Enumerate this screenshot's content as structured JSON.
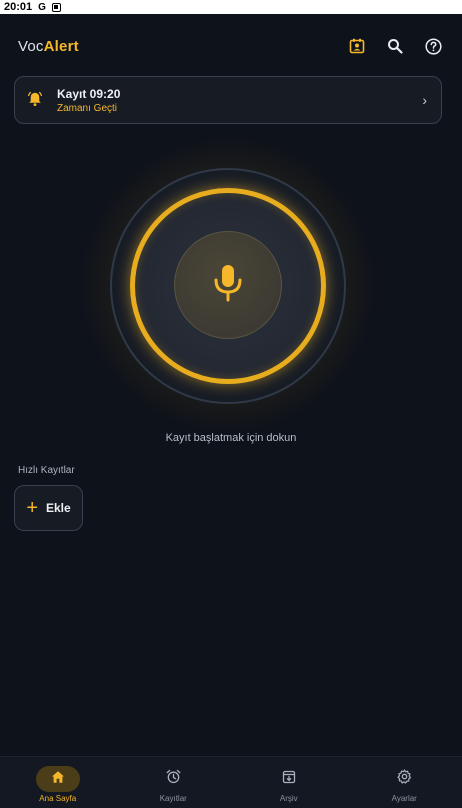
{
  "status_bar": {
    "time": "20:01",
    "icons": [
      "google-g",
      "a-box"
    ]
  },
  "app": {
    "name_prefix": "Voc",
    "name_suffix": "Alert"
  },
  "appbar_actions": [
    "contact-card-icon",
    "search-icon",
    "help-icon"
  ],
  "alert": {
    "title": "Kayıt 09:20",
    "subtitle": "Zamanı Geçti",
    "icon": "bell-icon"
  },
  "record": {
    "hint": "Kayıt başlatmak için dokun",
    "icon": "mic-icon"
  },
  "quick": {
    "label": "Hızlı Kayıtlar",
    "add_label": "Ekle"
  },
  "nav": [
    {
      "label": "Ana Sayfa",
      "icon": "home-icon",
      "active": true
    },
    {
      "label": "Kayıtlar",
      "icon": "alarm-icon",
      "active": false
    },
    {
      "label": "Arşiv",
      "icon": "archive-icon",
      "active": false
    },
    {
      "label": "Ayarlar",
      "icon": "gear-icon",
      "active": false
    }
  ],
  "colors": {
    "accent": "#f5b82a",
    "background": "#0e121a",
    "card": "#161b24"
  }
}
